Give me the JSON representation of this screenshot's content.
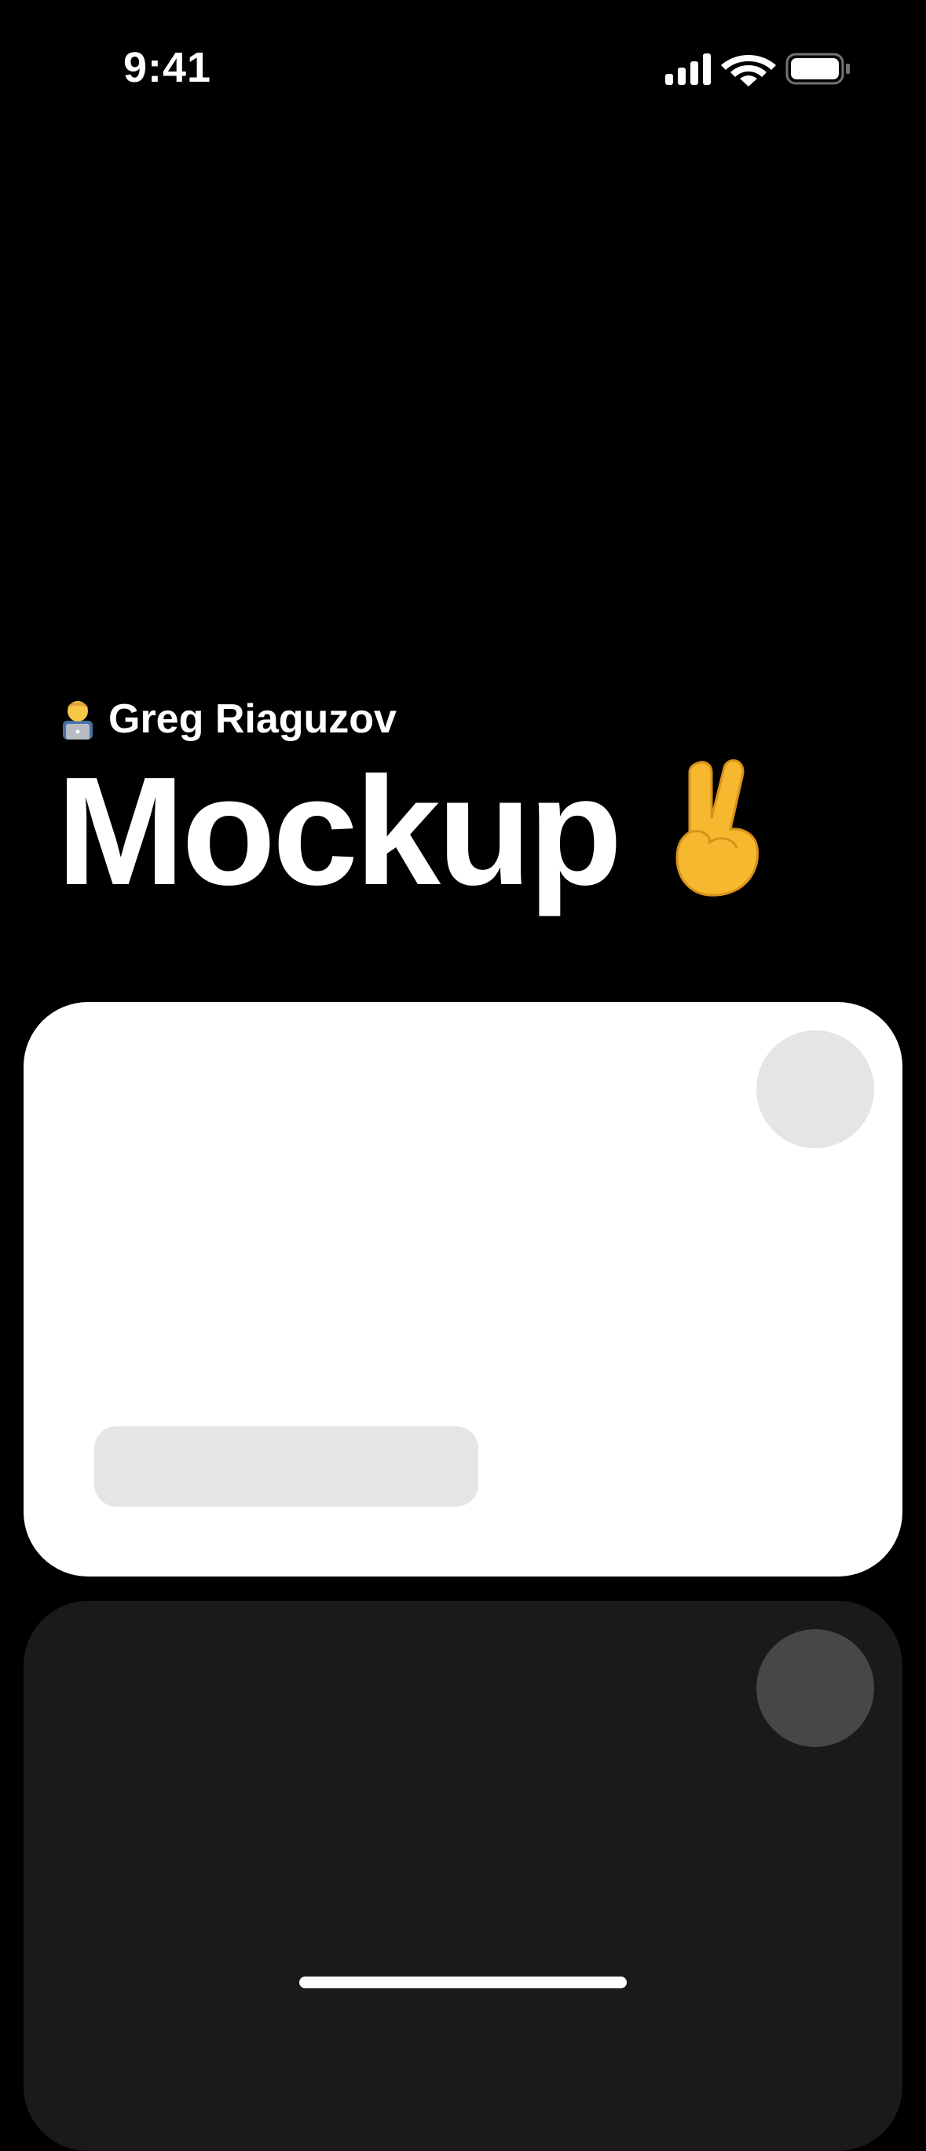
{
  "status_bar": {
    "time": "9:41",
    "icons": [
      "cellular-signal-icon",
      "wifi-icon",
      "battery-icon"
    ]
  },
  "header": {
    "author_emoji_icon": "technologist-emoji-icon",
    "author_name": "Greg Riaguzov",
    "title": "Mockup",
    "title_emoji_icon": "victory-hand-emoji-icon"
  },
  "cards": [
    {
      "theme": "light",
      "background": "#ffffff",
      "avatar_color": "#e5e5e5",
      "placeholder_color": "#e5e5e5"
    },
    {
      "theme": "dark",
      "background": "#1a1a1a",
      "avatar_color": "#474747"
    }
  ],
  "colors": {
    "background": "#000000",
    "text": "#ffffff"
  }
}
